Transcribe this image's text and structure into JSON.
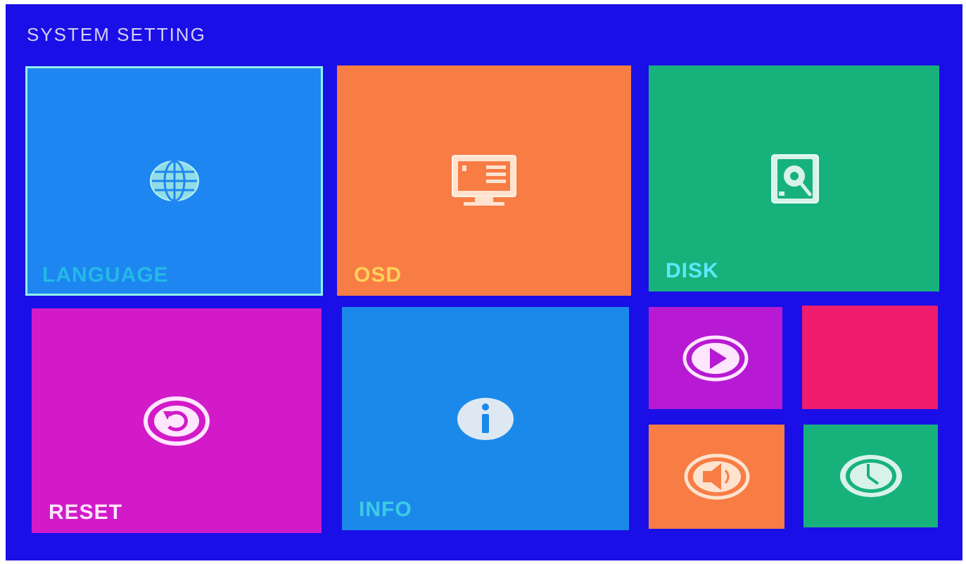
{
  "header": {
    "title": "SYSTEM SETTING"
  },
  "tiles": {
    "language": {
      "label": "LANGUAGE",
      "color": "#1d86f0",
      "label_color": "#24b9e6",
      "icon": "globe-icon",
      "selected": true
    },
    "osd": {
      "label": "OSD",
      "color": "#f77d45",
      "label_color": "#ffd25a",
      "icon": "monitor-icon"
    },
    "disk": {
      "label": "DISK",
      "color": "#17b27c",
      "label_color": "#61e6ff",
      "icon": "hard-disk-icon"
    },
    "reset": {
      "label": "RESET",
      "color": "#d21ac8",
      "label_color": "#ffe6ff",
      "icon": "reset-icon"
    },
    "info": {
      "label": "INFO",
      "color": "#1b89ea",
      "label_color": "#3dcbe6",
      "icon": "info-icon"
    },
    "playback": {
      "color": "#b71ad2",
      "icon": "play-icon"
    },
    "blank": {
      "color": "#f01c6e"
    },
    "audio": {
      "color": "#f77d45",
      "icon": "speaker-icon"
    },
    "time": {
      "color": "#17b27c",
      "icon": "clock-icon"
    }
  }
}
